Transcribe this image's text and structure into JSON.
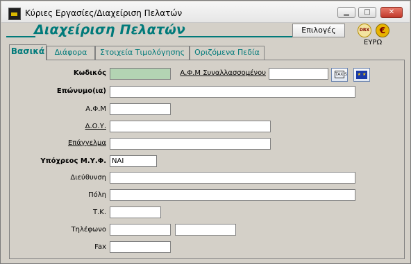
{
  "window": {
    "title": "Κύριες Εργασίες/Διαχείριση Πελατών",
    "controls": {
      "minimize": "▁",
      "maximize": "□",
      "close": "✕"
    }
  },
  "header": {
    "title": "Διαχείριση Πελατών",
    "options_button": "Επιλογές",
    "currency_drx": "DRX",
    "currency_eur": "€",
    "currency_label": "ΕΥΡΩ"
  },
  "tabs": [
    {
      "label": "Βασικά",
      "active": true
    },
    {
      "label": "Διάφορα",
      "active": false
    },
    {
      "label": "Στοιχεία Τιμολόγησης",
      "active": false
    },
    {
      "label": "Οριζόμενα Πεδία",
      "active": false
    }
  ],
  "form": {
    "code_label": "Κωδικός",
    "code_value": "",
    "counterparty_afm_label": "Α.Φ.Μ Συναλλασσομένου",
    "counterparty_afm_value": "",
    "taxis_icon_text": "TAXIS",
    "eu_icon_text": "★ ★",
    "surname_label": "Επώνυμο(ια)",
    "surname_value": "",
    "afm_label": "Α.Φ.Μ",
    "afm_value": "",
    "doy_label": "Δ.Ο.Υ.",
    "doy_value": "",
    "profession_label": "Επάγγελμα",
    "profession_value": "",
    "vat_label": "Υπόχρεος Μ.Υ.Φ.",
    "vat_value": "ΝΑΙ",
    "address_label": "Διεύθυνση",
    "address_value": "",
    "city_label": "Πόλη",
    "city_value": "",
    "zip_label": "Τ.Κ.",
    "zip_value": "",
    "phone_label": "Τηλέφωνο",
    "phone1_value": "",
    "phone2_value": "",
    "fax_label": "Fax",
    "fax_value": ""
  },
  "colors": {
    "accent": "#007a7a",
    "code_field": "#b3d4b3",
    "background": "#d4d0c8"
  }
}
